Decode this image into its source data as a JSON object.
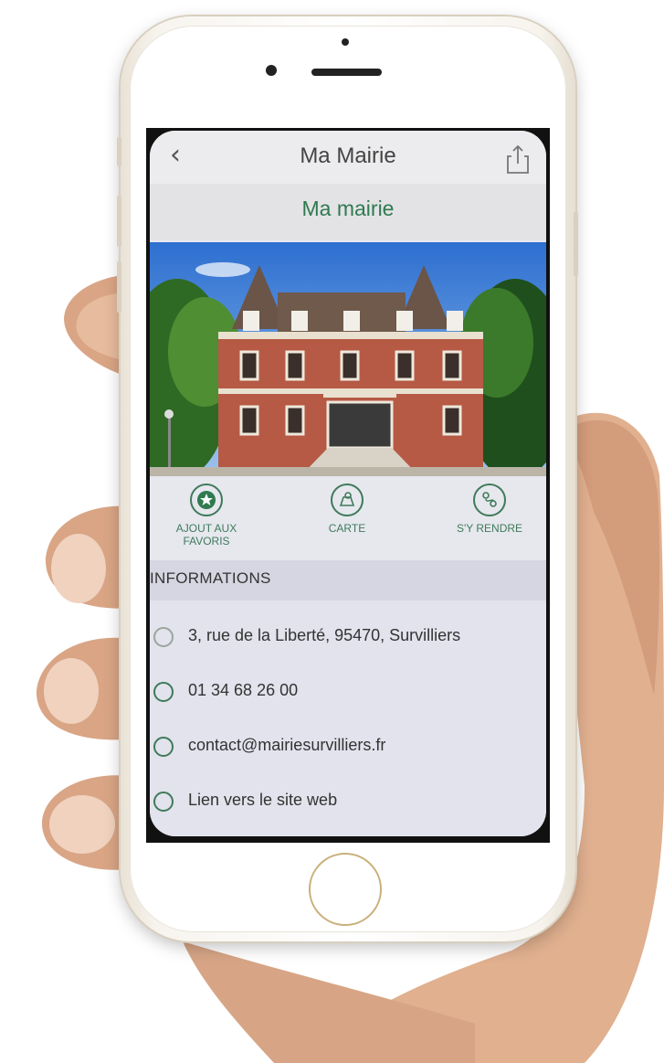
{
  "header": {
    "title": "Ma Mairie",
    "back_symbol": "‹",
    "share_icon": "share-icon"
  },
  "section": {
    "title": "Ma mairie"
  },
  "photo": {
    "icon": "town-hall-photo"
  },
  "actions": [
    {
      "label": "AJOUT AUX FAVORIS",
      "icon": "star-icon"
    },
    {
      "label": "CARTE",
      "icon": "map-icon"
    },
    {
      "label": "S'Y RENDRE",
      "icon": "directions-icon"
    }
  ],
  "info": {
    "title": "INFORMATIONS",
    "items": [
      {
        "text": "3, rue de la Liberté, 95470, Survilliers",
        "icon": "location-icon"
      },
      {
        "text": "01 34 68 26 00",
        "icon": "phone-icon"
      },
      {
        "text": "contact@mairiesurvilliers.fr",
        "icon": "at-icon"
      },
      {
        "text": "Lien vers le site web",
        "icon": "link-icon"
      }
    ]
  },
  "colors": {
    "accent": "#2f7a4f",
    "icon": "#3f7a5a"
  }
}
